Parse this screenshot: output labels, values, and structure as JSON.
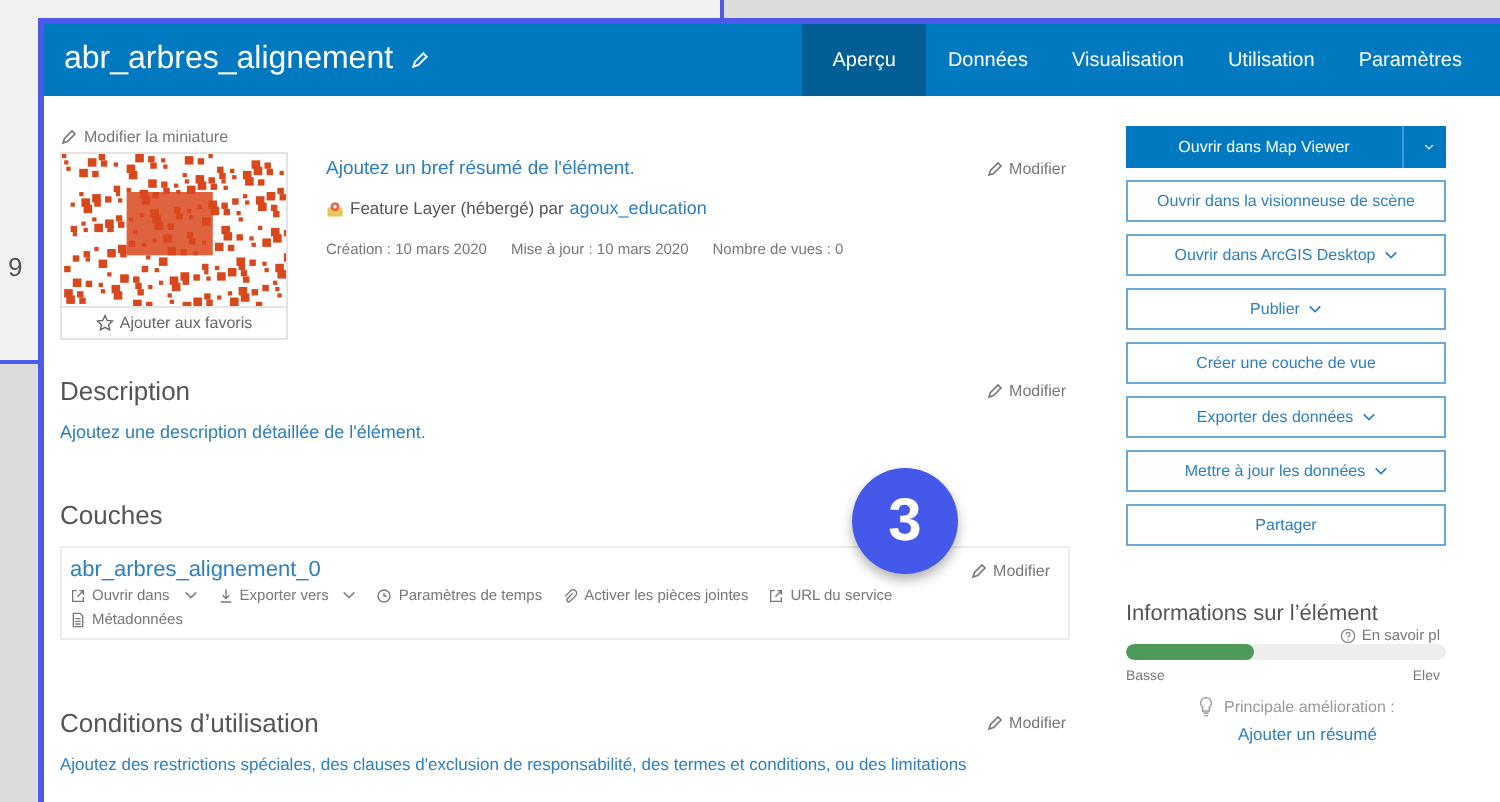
{
  "background_window": {
    "text": "9"
  },
  "header": {
    "title": "abr_arbres_alignement",
    "tabs": [
      {
        "label": "Aperçu",
        "selected": true
      },
      {
        "label": "Données",
        "selected": false
      },
      {
        "label": "Visualisation",
        "selected": false
      },
      {
        "label": "Utilisation",
        "selected": false
      },
      {
        "label": "Paramètres",
        "selected": false
      }
    ]
  },
  "overview": {
    "edit_thumbnail": "Modifier la miniature",
    "favorites": "Ajouter aux favoris",
    "summary_link": "Ajoutez un bref résumé de l'élément.",
    "edit": "Modifier",
    "item_type": "Feature Layer (hébergé) par",
    "owner": "agoux_education",
    "meta": [
      "Création : 10 mars 2020",
      "Mise à jour : 10 mars 2020",
      "Nombre de vues : 0"
    ]
  },
  "description": {
    "title": "Description",
    "edit": "Modifier",
    "link": "Ajoutez une description détaillée de l'élément."
  },
  "layers": {
    "title": "Couches",
    "edit": "Modifier",
    "name": "abr_arbres_alignement_0",
    "actions": [
      {
        "label": "Ouvrir dans",
        "kind": "open",
        "dropdown": true
      },
      {
        "label": "Exporter vers",
        "kind": "export",
        "dropdown": true
      },
      {
        "label": "Paramètres de temps",
        "kind": "time",
        "dropdown": false
      },
      {
        "label": "Activer les pièces jointes",
        "kind": "attachments",
        "dropdown": false
      },
      {
        "label": "URL du service",
        "kind": "url",
        "dropdown": false
      },
      {
        "label": "Métadonnées",
        "kind": "metadata",
        "dropdown": false
      }
    ]
  },
  "conditions": {
    "title": "Conditions d’utilisation",
    "edit": "Modifier",
    "link": "Ajoutez des restrictions spéciales, des clauses d'exclusion de responsabilité, des termes et conditions, ou des limitations"
  },
  "actions": [
    {
      "label": "Ouvrir dans Map Viewer",
      "kind": "primary",
      "dropdown": true
    },
    {
      "label": "Ouvrir dans la visionneuse de scène",
      "kind": "outline",
      "dropdown": false
    },
    {
      "label": "Ouvrir dans ArcGIS Desktop",
      "kind": "outline",
      "dropdown": true
    },
    {
      "label": "Publier",
      "kind": "outline",
      "dropdown": true
    },
    {
      "label": "Créer une couche de vue",
      "kind": "outline",
      "dropdown": false
    },
    {
      "label": "Exporter des données",
      "kind": "outline",
      "dropdown": true
    },
    {
      "label": "Mettre à jour les données",
      "kind": "outline",
      "dropdown": true
    },
    {
      "label": "Partager",
      "kind": "outline",
      "dropdown": false
    }
  ],
  "item_info": {
    "title": "Informations sur l’élément",
    "learn_more": "En savoir pl",
    "level": 0.4,
    "low": "Basse",
    "high": "Elev",
    "improvement_label": "Principale amélioration :",
    "improvement_link": "Ajouter un résumé"
  },
  "badge": {
    "text": "3"
  }
}
